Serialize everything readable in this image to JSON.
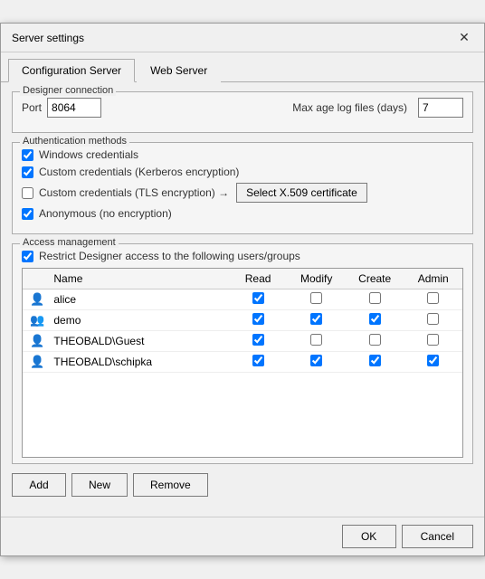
{
  "dialog": {
    "title": "Server settings",
    "close_label": "✕"
  },
  "tabs": [
    {
      "id": "config",
      "label": "Configuration Server",
      "active": true
    },
    {
      "id": "web",
      "label": "Web Server",
      "active": false
    }
  ],
  "designer_connection": {
    "section_label": "Designer connection",
    "port_label": "Port",
    "port_value": "8064",
    "maxage_label": "Max age log files (days)",
    "maxage_value": "7"
  },
  "auth_methods": {
    "section_label": "Authentication methods",
    "items": [
      {
        "id": "windows",
        "label": "Windows credentials",
        "checked": true
      },
      {
        "id": "kerberos",
        "label": "Custom credentials (Kerberos encryption)",
        "checked": true
      },
      {
        "id": "tls",
        "label": "Custom credentials (TLS encryption) →",
        "checked": false,
        "has_btn": true,
        "btn_label": "Select X.509 certificate"
      },
      {
        "id": "anon",
        "label": "Anonymous (no encryption)",
        "checked": true
      }
    ]
  },
  "access_management": {
    "section_label": "Access management",
    "restrict_label": "Restrict Designer access to the following users/groups",
    "restrict_checked": true,
    "table": {
      "columns": [
        "",
        "Name",
        "Read",
        "Modify",
        "Create",
        "Admin"
      ],
      "rows": [
        {
          "icon": "user",
          "name": "alice",
          "read": true,
          "modify": false,
          "create": false,
          "admin": false
        },
        {
          "icon": "group",
          "name": "demo",
          "read": true,
          "modify": true,
          "create": true,
          "admin": false
        },
        {
          "icon": "user",
          "name": "THEOBALD\\Guest",
          "read": true,
          "modify": false,
          "create": false,
          "admin": false
        },
        {
          "icon": "user",
          "name": "THEOBALD\\schipka",
          "read": true,
          "modify": true,
          "create": true,
          "admin": true
        }
      ]
    }
  },
  "actions": {
    "add_label": "Add",
    "new_label": "New",
    "remove_label": "Remove"
  },
  "footer": {
    "ok_label": "OK",
    "cancel_label": "Cancel"
  },
  "icons": {
    "user": "👤",
    "group": "👥",
    "close": "✕",
    "checked": "✔",
    "unchecked": ""
  }
}
